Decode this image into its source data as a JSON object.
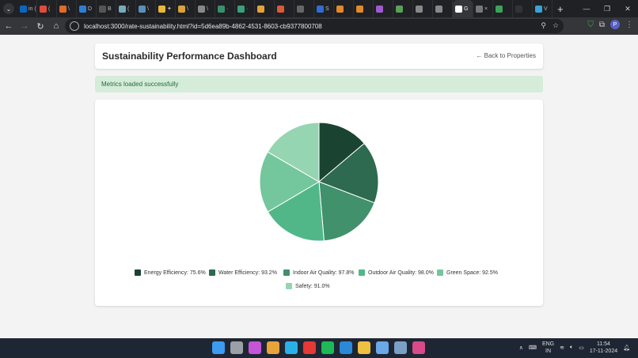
{
  "browser": {
    "url": "localhost:3000/rate-sustainability.html?id=5d6ea89b-4862-4531-8603-cb9377800708",
    "new_tab_label": "+",
    "profile_initial": "P",
    "tabs": [
      {
        "label": "in (",
        "color": "#0a66c2"
      },
      {
        "label": "(",
        "color": "#e24a3b"
      },
      {
        "label": "\\",
        "color": "#e06b2a"
      },
      {
        "label": "D",
        "color": "#2f7dd1"
      },
      {
        "label": "B",
        "color": "#555555"
      },
      {
        "label": "(",
        "color": "#7ab"
      },
      {
        "label": "\\",
        "color": "#5c8fb8"
      },
      {
        "label": "✦",
        "color": "#e6b93a"
      },
      {
        "label": "\\",
        "color": "#d9a23a"
      },
      {
        "label": "\\",
        "color": "#888888"
      },
      {
        "label": "·",
        "color": "#3a8f6b"
      },
      {
        "label": "·",
        "color": "#3a9f7b"
      },
      {
        "label": "",
        "color": "#e6a23a"
      },
      {
        "label": "",
        "color": "#d85a3a"
      },
      {
        "label": "",
        "color": "#666666"
      },
      {
        "label": "S",
        "color": "#2f6dd1"
      },
      {
        "label": "",
        "color": "#e08a2a"
      },
      {
        "label": "",
        "color": "#e08a2a"
      },
      {
        "label": "",
        "color": "#a05ad0"
      },
      {
        "label": "",
        "color": "#5a9f5a"
      },
      {
        "label": "",
        "color": "#888888"
      },
      {
        "label": "",
        "color": "#888888"
      },
      {
        "label": "G",
        "color": "#ffffff"
      },
      {
        "label": "×",
        "color": "#777777"
      },
      {
        "label": "",
        "color": "#3aa35a"
      },
      {
        "label": "",
        "color": "#333333"
      },
      {
        "label": "V",
        "color": "#3aa3d8"
      }
    ]
  },
  "page": {
    "title": "Sustainability Performance Dashboard",
    "back_link": "← Back to Properties",
    "alert": "Metrics loaded successfully"
  },
  "chart_data": {
    "type": "pie",
    "categories": [
      "Energy Efficiency",
      "Water Efficiency",
      "Indoor Air Quality",
      "Outdoor Air Quality",
      "Green Space",
      "Safety"
    ],
    "values": [
      75.6,
      93.2,
      97.8,
      98.0,
      92.5,
      91.0
    ],
    "colors": [
      "#1b4332",
      "#2d6a4f",
      "#40916c",
      "#52b788",
      "#74c69d",
      "#95d5b2"
    ],
    "legend_labels": [
      "Energy Efficiency: 75.6%",
      "Water Efficiency: 93.2%",
      "Indoor Air Quality: 97.8%",
      "Outdoor Air Quality: 98.0%",
      "Green Space: 92.5%",
      "Safety: 91.0%"
    ],
    "legend_position": "bottom"
  },
  "taskbar": {
    "icons": [
      {
        "name": "windows-start-icon",
        "color": "#3b9cf0"
      },
      {
        "name": "task-view-icon",
        "color": "#9aa0a6"
      },
      {
        "name": "copilot-icon",
        "color": "#c455d8"
      },
      {
        "name": "chrome-icon",
        "color": "#e8a33a"
      },
      {
        "name": "cortana-icon",
        "color": "#2ab0e8"
      },
      {
        "name": "youtube-icon",
        "color": "#e53935"
      },
      {
        "name": "spotify-icon",
        "color": "#1db954"
      },
      {
        "name": "vscode-icon",
        "color": "#2a8ad8"
      },
      {
        "name": "file-explorer-icon",
        "color": "#f0c040"
      },
      {
        "name": "notepad-icon",
        "color": "#6aa8e8"
      },
      {
        "name": "app-icon",
        "color": "#7aa0c8"
      },
      {
        "name": "snipping-tool-icon",
        "color": "#d84a8a"
      }
    ],
    "lang_top": "ENG",
    "lang_bottom": "IN",
    "time": "11:54",
    "date": "17-11-2024"
  }
}
